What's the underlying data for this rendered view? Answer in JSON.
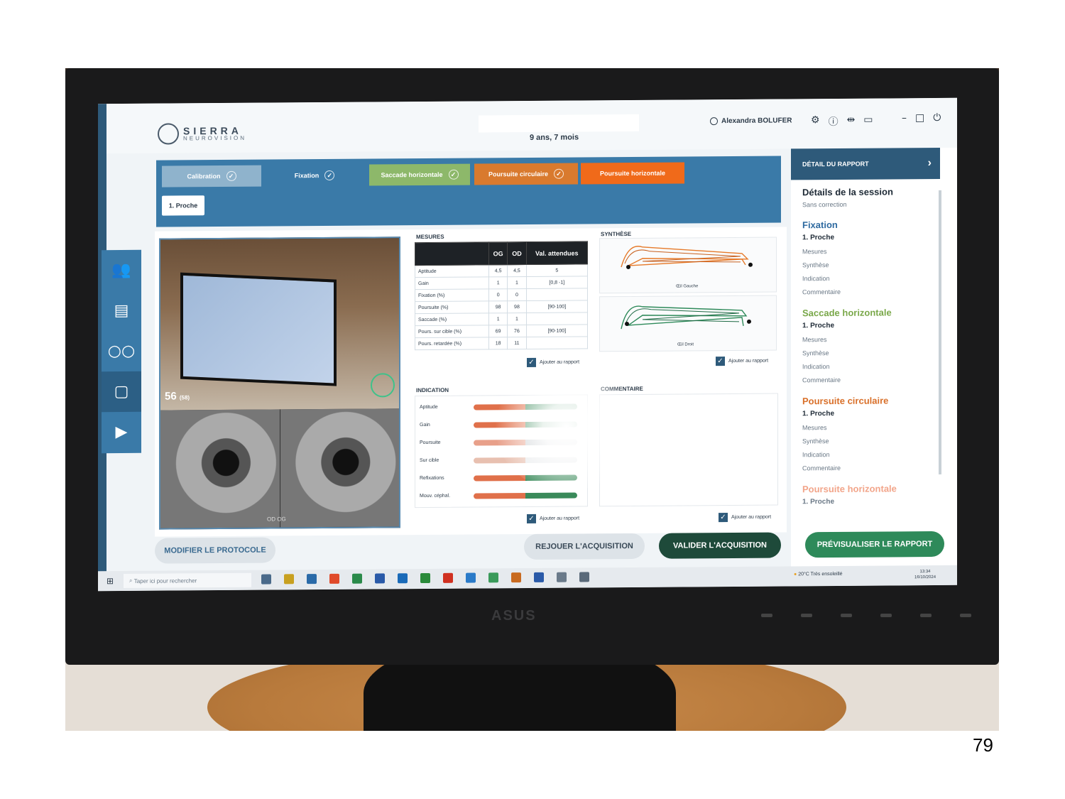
{
  "app": {
    "logo_line1": "SIERRA",
    "logo_line2": "NEUROVISION",
    "patient_age": "9 ans, 7 mois",
    "user_name": "Alexandra BOLUFER",
    "monitor_brand": "ASUS"
  },
  "steps": [
    {
      "label": "Calibration",
      "state": "done",
      "color": "#8fb3cc"
    },
    {
      "label": "Fixation",
      "state": "done",
      "color": "#3a7aa8"
    },
    {
      "label": "Saccade horizontale",
      "state": "done",
      "color": "#8db86a"
    },
    {
      "label": "Poursuite circulaire",
      "state": "done",
      "color": "#d97a2e"
    },
    {
      "label": "Poursuite horizontale",
      "state": "active",
      "color": "#f06a1a"
    }
  ],
  "substep": "1. Proche",
  "camera": {
    "count": "56",
    "count_sub": "(58)",
    "eye_labels": "OD  OG"
  },
  "measures": {
    "title": "MESURES",
    "headers": [
      "",
      "OG",
      "OD",
      "Val. attendues"
    ],
    "rows": [
      [
        "Aptitude",
        "4,5",
        "4,5",
        "5"
      ],
      [
        "Gain",
        "1",
        "1",
        "[0,8 -1]"
      ],
      [
        "Fixation (%)",
        "0",
        "0",
        ""
      ],
      [
        "Poursuite (%)",
        "98",
        "98",
        "[90-100]"
      ],
      [
        "Saccade (%)",
        "1",
        "1",
        ""
      ],
      [
        "Pours. sur cible (%)",
        "69",
        "76",
        "[90-100]"
      ],
      [
        "Pours. retardée (%)",
        "18",
        "11",
        ""
      ]
    ],
    "add_to_report": "Ajouter au rapport"
  },
  "synthese": {
    "title": "SYNTHÈSE",
    "left_eye": "Œil Gauche",
    "right_eye": "Œil Droit",
    "add_to_report": "Ajouter au rapport"
  },
  "indication": {
    "title": "INDICATION",
    "rows": [
      "Aptitude",
      "Gain",
      "Poursuite",
      "Sur cible",
      "Refixations",
      "Mouv. céphal."
    ],
    "add_to_report": "Ajouter au rapport"
  },
  "comment": {
    "title": "COMMENTAIRE",
    "add_to_report": "Ajouter au rapport"
  },
  "buttons": {
    "modify": "MODIFIER LE PROTOCOLE",
    "replay": "REJOUER L'ACQUISITION",
    "validate": "VALIDER L'ACQUISITION",
    "preview": "PRÉVISUALISER LE RAPPORT"
  },
  "report": {
    "header": "DÉTAIL DU RAPPORT",
    "session_title": "Détails de la session",
    "session_sub": "Sans correction",
    "sections": [
      {
        "title": "Fixation",
        "color": "#2e6aa0",
        "sub": "1. Proche",
        "items": [
          "Mesures",
          "Synthèse",
          "Indication",
          "Commentaire"
        ]
      },
      {
        "title": "Saccade horizontale",
        "color": "#7aa84a",
        "sub": "1. Proche",
        "items": [
          "Mesures",
          "Synthèse",
          "Indication",
          "Commentaire"
        ]
      },
      {
        "title": "Poursuite circulaire",
        "color": "#d9702a",
        "sub": "1. Proche",
        "items": [
          "Mesures",
          "Synthèse",
          "Indication",
          "Commentaire"
        ]
      },
      {
        "title": "Poursuite horizontale",
        "color": "#f2a58a",
        "sub": "1. Proche",
        "items": []
      }
    ]
  },
  "taskbar": {
    "search_placeholder": "Taper ici pour rechercher",
    "weather": "20°C  Très ensoleillé",
    "time": "13:34",
    "date": "16/10/2024"
  },
  "page_number": "79"
}
